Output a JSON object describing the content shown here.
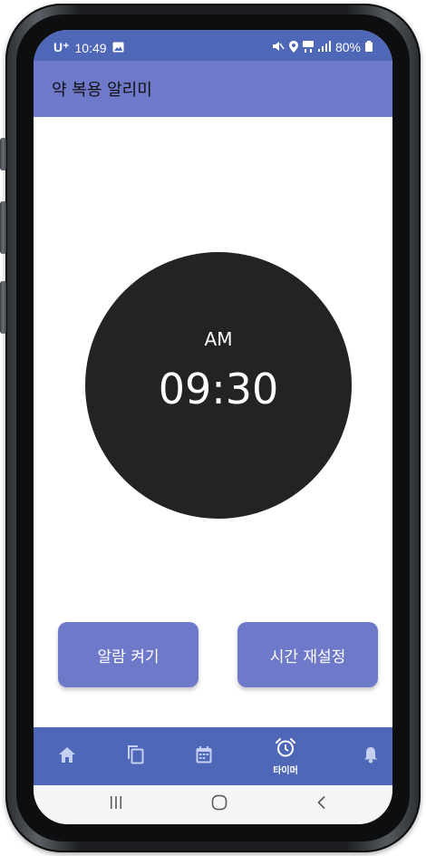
{
  "status_bar": {
    "carrier": "U⁺",
    "time": "10:49",
    "battery_percent": "80%"
  },
  "app_bar": {
    "title": "약 복용 알리미"
  },
  "clock": {
    "ampm": "AM",
    "time": "09:30"
  },
  "buttons": {
    "alarm_on": "알람 켜기",
    "reset_time": "시간 재설정"
  },
  "bottom_nav": {
    "items": [
      {
        "icon": "home-icon"
      },
      {
        "icon": "copy-icon"
      },
      {
        "icon": "calendar-icon"
      },
      {
        "icon": "alarm-clock-icon",
        "label": "타이머",
        "active": true
      },
      {
        "icon": "bell-icon"
      }
    ]
  },
  "system_nav": {
    "items": [
      "recent-apps",
      "home",
      "back"
    ]
  },
  "colors": {
    "status_bar": "#4f67b7",
    "app_bar": "#6f79c9",
    "accent_button": "#6f79c9",
    "clock_face": "#232224",
    "bottom_nav": "#4f67b7"
  }
}
